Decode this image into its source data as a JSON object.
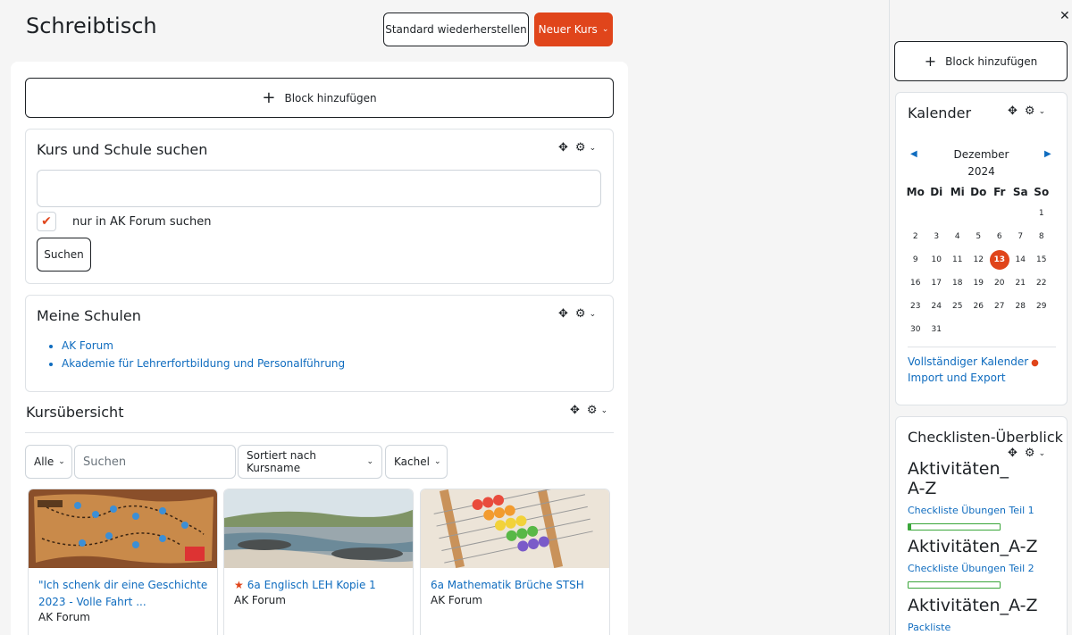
{
  "header": {
    "title": "Schreibtisch",
    "reset_label": "Standard wiederherstellen",
    "new_course_label": "Neuer Kurs",
    "new_course_chevron": "⌄"
  },
  "main": {
    "add_block_label": "Block hinzufügen",
    "search_block": {
      "title": "Kurs und Schule suchen",
      "input_value": "",
      "checkbox_checked": true,
      "checkbox_label": "nur in AK Forum suchen",
      "search_button": "Suchen"
    },
    "schools_block": {
      "title": "Meine Schulen",
      "items": [
        "AK Forum",
        "Akademie für Lehrerfortbildung und Personalführung"
      ]
    },
    "overview": {
      "title": "Kursübersicht",
      "filter_all": "Alle",
      "search_placeholder": "Suchen",
      "sort_label": "Sortiert nach Kursname",
      "view_label": "Kachel",
      "courses": [
        {
          "name": "\"Ich schenk dir eine Geschichte 2023 - Volle Fahrt ...",
          "category": "AK Forum",
          "starred": false
        },
        {
          "name": "6a Englisch LEH Kopie 1",
          "category": "AK Forum",
          "starred": true
        },
        {
          "name": "6a Mathematik Brüche STSH",
          "category": "AK Forum",
          "starred": false
        }
      ]
    }
  },
  "drawer": {
    "add_block_label": "Block hinzufügen",
    "calendar": {
      "title": "Kalender",
      "month": "Dezember",
      "year": "2024",
      "weekdays": [
        "Mo",
        "Di",
        "Mi",
        "Do",
        "Fr",
        "Sa",
        "So"
      ],
      "weeks": [
        [
          "",
          "",
          "",
          "",
          "",
          "",
          "1"
        ],
        [
          "2",
          "3",
          "4",
          "5",
          "6",
          "7",
          "8"
        ],
        [
          "9",
          "10",
          "11",
          "12",
          "13",
          "14",
          "15"
        ],
        [
          "16",
          "17",
          "18",
          "19",
          "20",
          "21",
          "22"
        ],
        [
          "23",
          "24",
          "25",
          "26",
          "27",
          "28",
          "29"
        ],
        [
          "30",
          "31",
          "",
          "",
          "",
          "",
          ""
        ]
      ],
      "today": "13",
      "full_calendar_link": "Vollständiger Kalender",
      "import_export_link": "Import und Export"
    },
    "checklists": {
      "title": "Checklisten-Überblick",
      "groups": [
        {
          "heading": "Aktivitäten_ A-Z",
          "link": "Checkliste Übungen Teil 1",
          "progress": 0.03
        },
        {
          "heading": "Aktivitäten_A-Z",
          "link": "Checkliste Übungen Teil 2",
          "progress": 0
        },
        {
          "heading": "Aktivitäten_A-Z",
          "link": "Packliste"
        }
      ]
    }
  },
  "colors": {
    "accent": "#e0451b",
    "link": "#0f6cbf",
    "progress": "#3aa63a"
  }
}
